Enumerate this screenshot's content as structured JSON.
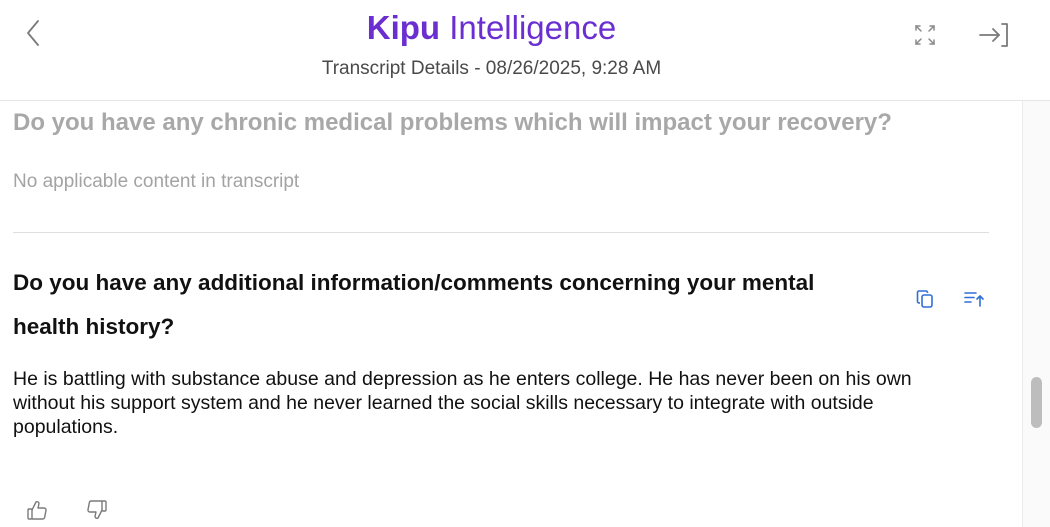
{
  "header": {
    "brand": "Kipu",
    "product": " Intelligence",
    "subtitle": "Transcript Details - 08/26/2025, 9:28 AM",
    "icons": {
      "back": "chevron-left-icon",
      "expand": "expand-icon",
      "exit": "exit-panel-icon"
    }
  },
  "sections": [
    {
      "question": "Do you have any chronic medical problems which will impact your recovery?",
      "answer": "No applicable content in transcript"
    },
    {
      "question": "Do you have any additional information/comments concerning your mental health history?",
      "answer": "He is battling with substance abuse and depression as he enters college. He has never been on his own without his support system and he never learned the social skills necessary to integrate with outside populations.",
      "actions": {
        "copy": "copy-icon",
        "insert": "insert-text-icon"
      },
      "feedback": {
        "like": "thumbs-up-icon",
        "dislike": "thumbs-down-icon"
      }
    }
  ],
  "colors": {
    "brand": "#6b2fd1",
    "accent_blue": "#2f6fd6",
    "faded_text": "#a8a8a8"
  }
}
